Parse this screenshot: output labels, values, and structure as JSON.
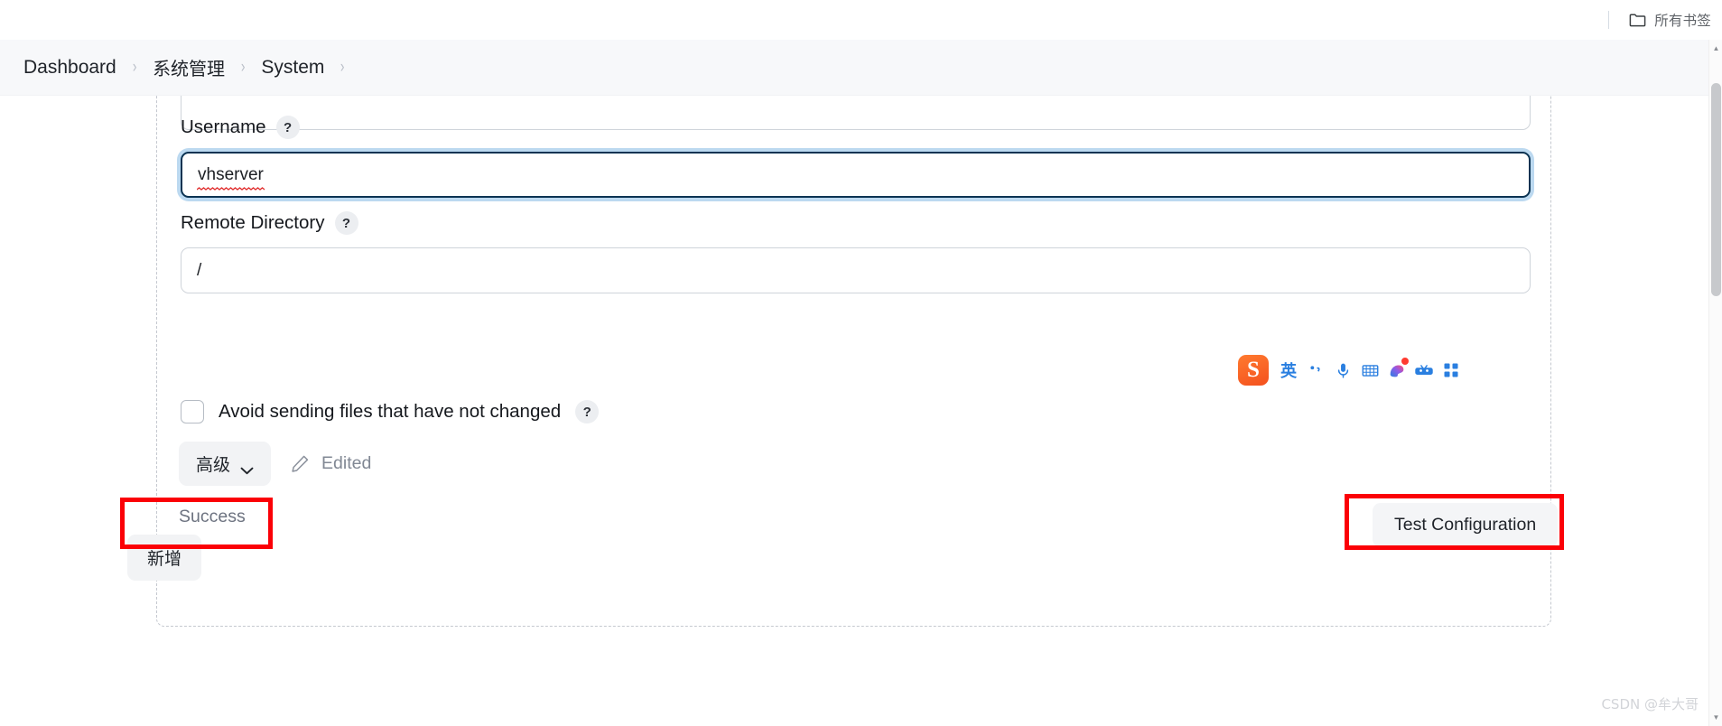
{
  "browser": {
    "bookmarks_label": "所有书签",
    "folder_icon": "folder-icon"
  },
  "breadcrumb": {
    "separator": "›",
    "items": [
      {
        "label": "Dashboard"
      },
      {
        "label": "系统管理"
      },
      {
        "label": "System"
      }
    ]
  },
  "form": {
    "username": {
      "label": "Username",
      "help": "?",
      "value": "vhserver",
      "placeholder": "",
      "focused": true,
      "spellcheck_error": true
    },
    "remote_directory": {
      "label": "Remote Directory",
      "help": "?",
      "value": "/",
      "placeholder": ""
    },
    "avoid_sending": {
      "label": "Avoid sending files that have not changed",
      "help": "?",
      "checked": false
    },
    "advanced_button": {
      "label": "高级",
      "chevron": "chevron-down-icon"
    },
    "edited": {
      "label": "Edited",
      "icon": "pencil-icon"
    },
    "status": {
      "text": "Success"
    },
    "test_configuration": {
      "label": "Test Configuration"
    },
    "add_button": {
      "label": "新增"
    }
  },
  "ime": {
    "logo": "S",
    "items": [
      {
        "name": "language-mode",
        "glyph": "英"
      },
      {
        "name": "punctuation-toggle",
        "glyph": "•,"
      },
      {
        "name": "voice-input-icon",
        "glyph": ""
      },
      {
        "name": "soft-keyboard-icon",
        "glyph": ""
      },
      {
        "name": "skin-icon",
        "glyph": ""
      },
      {
        "name": "emoji-icon",
        "glyph": ""
      },
      {
        "name": "toolbox-icon",
        "glyph": ""
      }
    ]
  },
  "watermark": {
    "text": "CSDN @牟大哥"
  },
  "colors": {
    "accent_focus": "#0b3352",
    "focus_ring": "#bcd9f0",
    "annotation": "#fb0007",
    "header_bg": "#f7f8fa",
    "ime_blue": "#2a7fe0",
    "ime_orange": "#f4511e"
  }
}
